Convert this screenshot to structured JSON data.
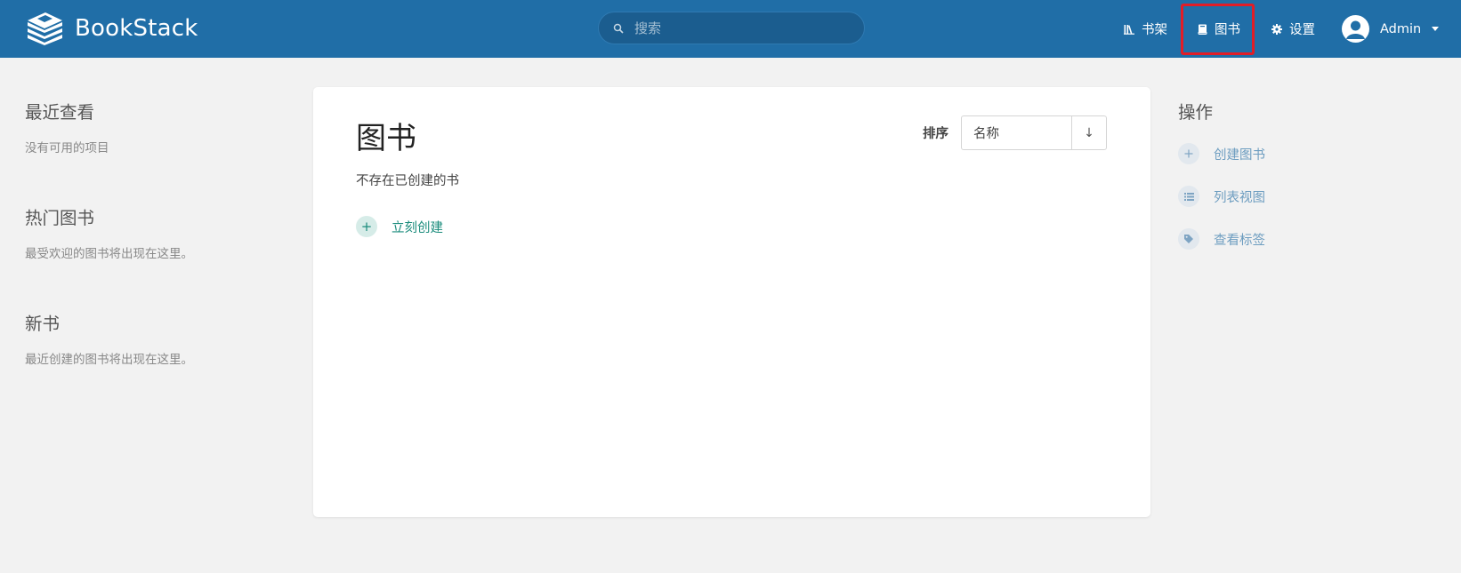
{
  "header": {
    "brand": "BookStack",
    "search_placeholder": "搜索",
    "nav": {
      "shelves": "书架",
      "books": "图书",
      "settings": "设置"
    },
    "user_name": "Admin"
  },
  "left": {
    "recent_title": "最近查看",
    "recent_empty": "没有可用的项目",
    "popular_title": "热门图书",
    "popular_empty": "最受欢迎的图书将出现在这里。",
    "new_title": "新书",
    "new_empty": "最近创建的图书将出现在这里。"
  },
  "main": {
    "title": "图书",
    "sort_label": "排序",
    "sort_value": "名称",
    "sort_direction": "↓",
    "empty_text": "不存在已创建的书",
    "create_now": "立刻创建"
  },
  "actions": {
    "title": "操作",
    "items": [
      {
        "label": "创建图书",
        "icon": "plus-icon"
      },
      {
        "label": "列表视图",
        "icon": "list-icon"
      },
      {
        "label": "查看标签",
        "icon": "tag-icon"
      }
    ]
  },
  "colors": {
    "header_bg": "#206ea7",
    "link": "#1b8c7c",
    "action_link": "#6d9dc0",
    "highlight": "#e11d27"
  }
}
